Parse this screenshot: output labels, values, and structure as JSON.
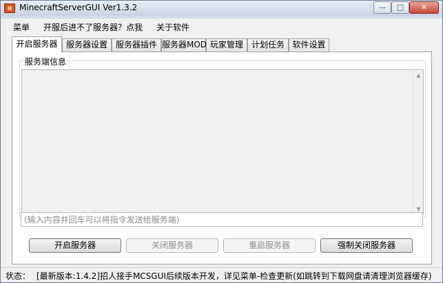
{
  "window": {
    "title": "MinecraftServerGUI Ver1.3.2",
    "controls": {
      "minimize": "—",
      "maximize": "□",
      "close": "✕"
    }
  },
  "menubar": {
    "items": [
      "菜单",
      "开服后进不了服务器？点我",
      "关于软件"
    ]
  },
  "tabs": [
    "开启服务器",
    "服务器设置",
    "服务器插件",
    "服务器MOD",
    "玩家管理",
    "计划任务",
    "软件设置"
  ],
  "active_tab_index": 0,
  "server_info": {
    "group_label": "服务端信息",
    "log_text": ""
  },
  "command_input": {
    "placeholder": "(输入内容并回车可以将指令发送给服务端)",
    "value": ""
  },
  "buttons": {
    "start": "开启服务器",
    "stop": "关闭服务器",
    "restart": "重启服务器",
    "force_stop": "强制关闭服务器"
  },
  "statusbar": {
    "label": "状态：",
    "text": "[最新版本:1.4.2]招人接手MCSGUI后续版本开发，详见菜单-检查更新(如跳转到下载网盘请清理浏览器缓存)"
  },
  "colors": {
    "title_gradient_top": "#e8edf5",
    "close_button": "#c7483a",
    "app_icon": "#d3541c"
  }
}
